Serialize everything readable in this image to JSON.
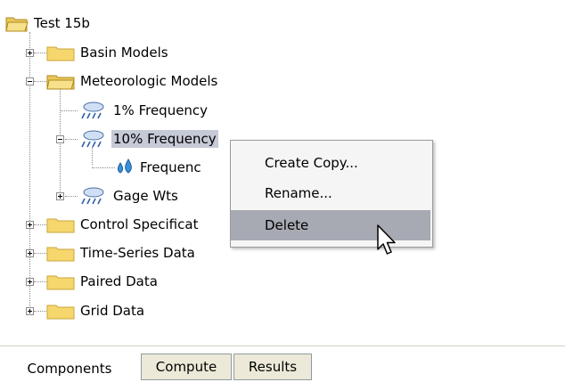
{
  "tree": {
    "root": "Test 15b",
    "basin_models": "Basin Models",
    "meteorologic_models": "Meteorologic Models",
    "met_1pct": "1% Frequency",
    "met_10pct": "10% Frequency",
    "met_10pct_child": "Frequenc",
    "gage_wts": "Gage Wts",
    "control_spec": "Control Specificat",
    "time_series": "Time-Series Data",
    "paired_data": "Paired Data",
    "grid_data": "Grid Data"
  },
  "context_menu": {
    "create_copy": "Create Copy...",
    "rename": "Rename...",
    "delete": "Delete"
  },
  "tabs": {
    "components": "Components",
    "compute": "Compute",
    "results": "Results"
  },
  "colors": {
    "selection": "#c6c9d6",
    "menu_highlight": "#a7a9b3",
    "folder": "#f5d76e"
  }
}
